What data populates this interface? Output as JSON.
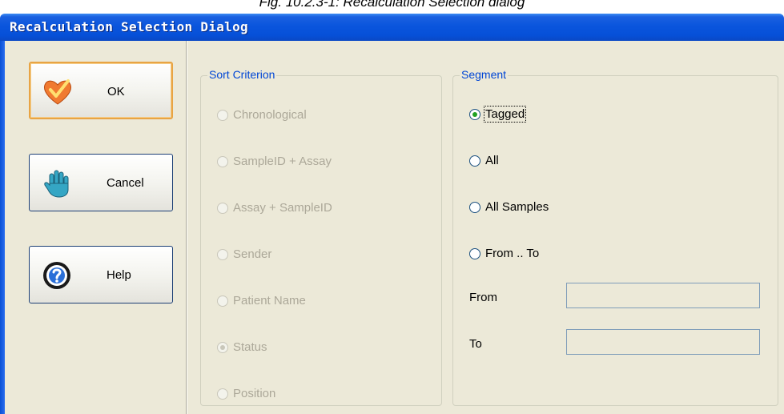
{
  "caption": "Fig. 10.2.3-1: Recalculation Selection dialog",
  "window": {
    "title": "Recalculation Selection Dialog"
  },
  "buttons": [
    {
      "label": "OK",
      "icon": "heart-check-icon",
      "default": true
    },
    {
      "label": "Cancel",
      "icon": "hand-stop-icon"
    },
    {
      "label": "Help",
      "icon": "help-question-icon"
    }
  ],
  "sort": {
    "title": "Sort Criterion",
    "selected": "Status",
    "options": [
      "Chronological",
      "SampleID + Assay",
      "Assay + SampleID",
      "Sender",
      "Patient Name",
      "Status",
      "Position"
    ]
  },
  "segment": {
    "title": "Segment",
    "selected": "Tagged",
    "options": [
      "Tagged",
      "All",
      "All Samples",
      "From .. To"
    ],
    "from_label": "From",
    "from_value": "",
    "to_label": "To",
    "to_value": ""
  },
  "colors": {
    "titlebar": "#0650d8",
    "legend": "#0046d5",
    "default_border": "#e8a444",
    "radio_dot": "#21a121"
  }
}
